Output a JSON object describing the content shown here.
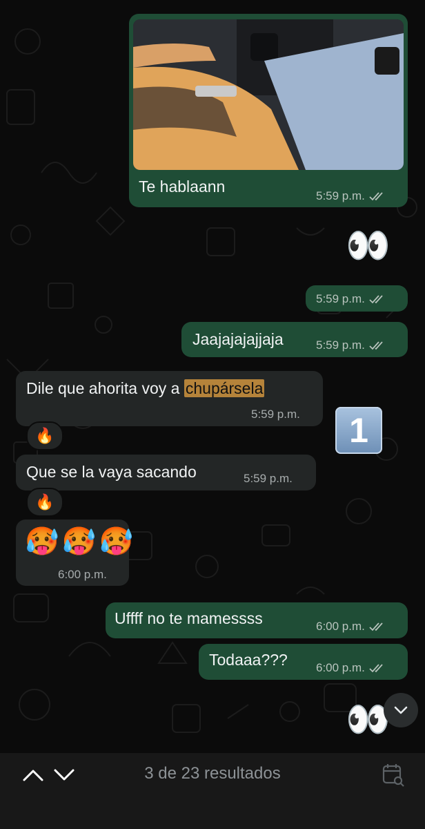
{
  "messages": {
    "m1": {
      "text": "Te hablaann",
      "time": "5:59 p.m."
    },
    "m2": {
      "emoji": "👀"
    },
    "m3": {
      "time": "5:59 p.m."
    },
    "m4": {
      "text": "Jaajajajajjaja",
      "time": "5:59 p.m."
    },
    "m5": {
      "text_before": "Dile que ahorita voy a ",
      "text_highlight": "chupársela",
      "time": "5:59 p.m.",
      "reaction": "🔥"
    },
    "m6": {
      "text": "Que se la vaya sacando",
      "time": "5:59 p.m.",
      "reaction": "🔥"
    },
    "m7": {
      "emojis": "🥵🥵🥵",
      "time": "6:00 p.m."
    },
    "m8": {
      "text": "Uffff no te mamessss",
      "time": "6:00 p.m."
    },
    "m9": {
      "text": "Todaaa???",
      "time": "6:00 p.m."
    },
    "m10": {
      "emoji": "👀"
    }
  },
  "badge": {
    "label": "1"
  },
  "search": {
    "results_text": "3 de 23 resultados"
  },
  "icons": {
    "up": "chevron-up-icon",
    "down": "chevron-down-icon",
    "calendar": "calendar-search-icon",
    "scroll": "chevron-down-icon",
    "ticks": "double-check-icon"
  },
  "colors": {
    "outgoing_bubble": "#1f4d36",
    "incoming_bubble": "#232626",
    "background": "#0b0b0b",
    "highlight": "#b5833a",
    "bottom_bar": "#181818"
  }
}
